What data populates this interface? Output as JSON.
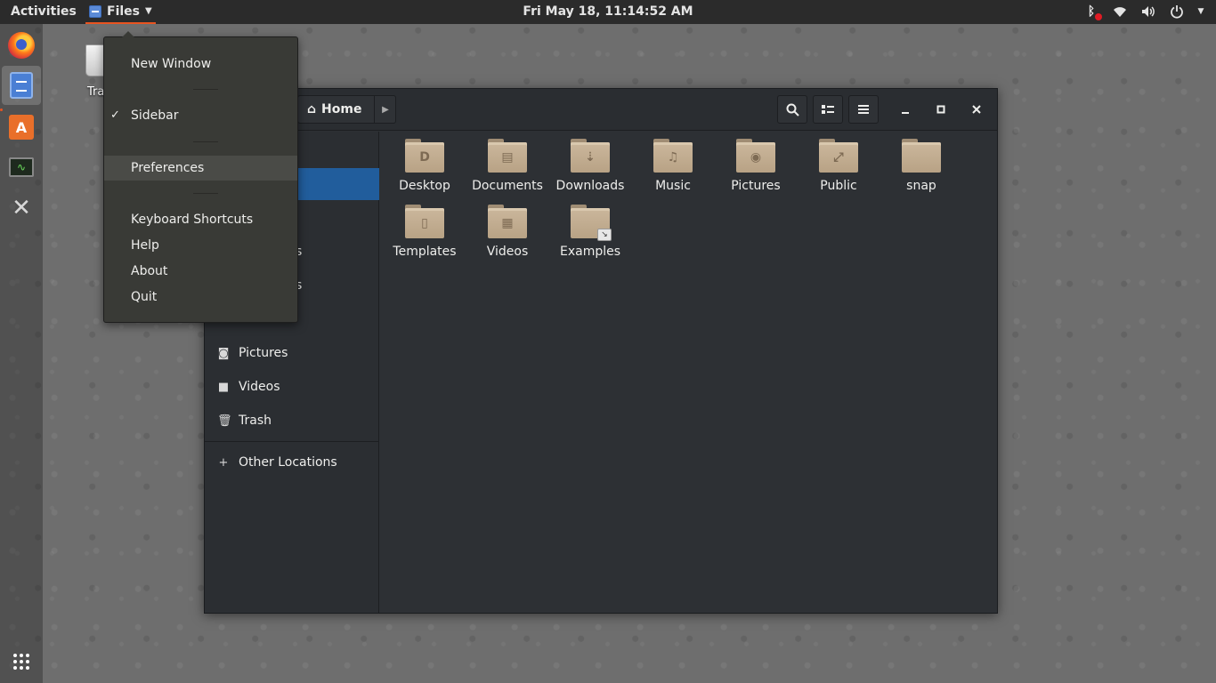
{
  "topbar": {
    "activities": "Activities",
    "app_name": "Files",
    "clock": "Fri May 18, 11:14:52 AM",
    "icons": [
      "bluetooth-icon",
      "wifi-icon",
      "volume-icon",
      "power-icon"
    ]
  },
  "desktop": {
    "trash_label": "Tra"
  },
  "dock": {
    "items": [
      "firefox-icon",
      "files-icon",
      "software-icon",
      "system-monitor-icon",
      "tools-icon",
      "show-apps-icon"
    ]
  },
  "app_menu": {
    "new_window": "New Window",
    "sidebar": "Sidebar",
    "sidebar_checked": "✓",
    "preferences": "Preferences",
    "keyboard_shortcuts": "Keyboard Shortcuts",
    "help": "Help",
    "about": "About",
    "quit": "Quit"
  },
  "window": {
    "path": "Home",
    "sidebar_visible": {
      "partial_1": "s",
      "partial_2": "s",
      "pictures": "Pictures",
      "videos": "Videos",
      "trash": "Trash",
      "other_locations": "Other Locations"
    },
    "files": [
      {
        "name": "Desktop",
        "glyph": "D"
      },
      {
        "name": "Documents",
        "glyph": "▤"
      },
      {
        "name": "Downloads",
        "glyph": "⇣"
      },
      {
        "name": "Music",
        "glyph": "♫"
      },
      {
        "name": "Pictures",
        "glyph": "◉"
      },
      {
        "name": "Public",
        "glyph": "⤢"
      },
      {
        "name": "snap",
        "glyph": ""
      },
      {
        "name": "Templates",
        "glyph": "▯"
      },
      {
        "name": "Videos",
        "glyph": "▦"
      },
      {
        "name": "Examples",
        "glyph": ""
      }
    ]
  },
  "colors": {
    "accent": "#e95420",
    "selection": "#215d9c",
    "folder": "#c3ad90",
    "menu_bg": "#393a36",
    "window_bg": "#2d3034"
  }
}
